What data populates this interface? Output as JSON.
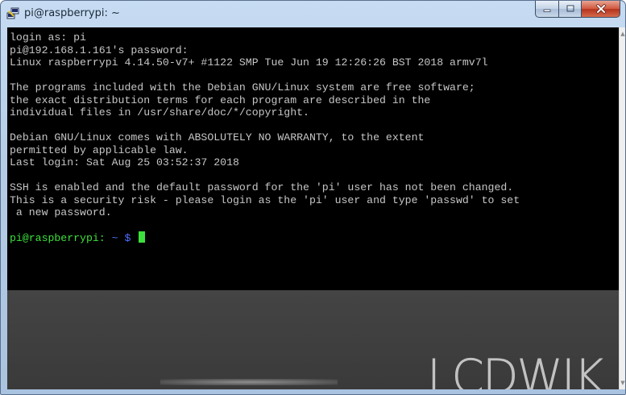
{
  "window": {
    "title": "pi@raspberrypi: ~",
    "app_icon": "putty-icon",
    "controls": {
      "minimize_icon": "minimize-icon",
      "maximize_icon": "maximize-icon",
      "close_icon": "close-icon"
    }
  },
  "terminal": {
    "lines": [
      "login as: pi",
      "pi@192.168.1.161's password:",
      "Linux raspberrypi 4.14.50-v7+ #1122 SMP Tue Jun 19 12:26:26 BST 2018 armv7l",
      "",
      "The programs included with the Debian GNU/Linux system are free software;",
      "the exact distribution terms for each program are described in the",
      "individual files in /usr/share/doc/*/copyright.",
      "",
      "Debian GNU/Linux comes with ABSOLUTELY NO WARRANTY, to the extent",
      "permitted by applicable law.",
      "Last login: Sat Aug 25 03:52:37 2018",
      "",
      "SSH is enabled and the default password for the 'pi' user has not been changed.",
      "This is a security risk - please login as the 'pi' user and type 'passwd' to set",
      " a new password.",
      ""
    ],
    "prompt": {
      "user_host": "pi@raspberrypi:",
      "path_and_symbol": "~ $"
    },
    "colors": {
      "background": "#000000",
      "text": "#c6c6c6",
      "prompt": "#3ce03c",
      "path": "#4d6fff",
      "cursor": "#3ce03c"
    }
  },
  "watermark": {
    "text": "LCDWIK"
  },
  "scrollbar": {
    "up_icon": "scroll-up-arrow-icon",
    "down_icon": "scroll-down-arrow-icon"
  }
}
